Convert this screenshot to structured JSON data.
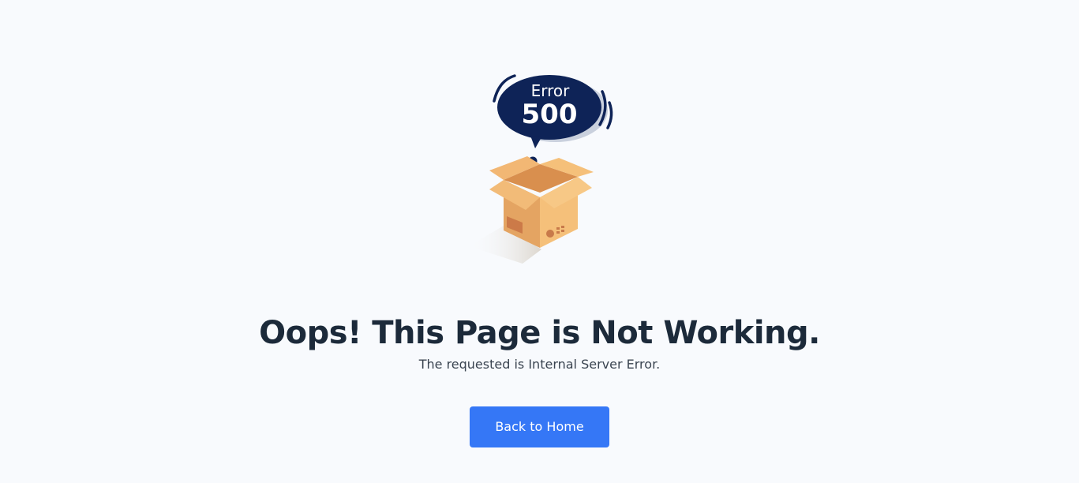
{
  "illustration": {
    "bubble_label": "Error",
    "bubble_code": "500",
    "icon": "open-box-icon"
  },
  "content": {
    "title": "Oops! This Page is Not Working.",
    "subtitle": "The requested is Internal Server Error."
  },
  "actions": {
    "home_label": "Back to Home"
  },
  "colors": {
    "background": "#f8fafd",
    "heading": "#1c2a3a",
    "bubble": "#0e2357",
    "box": "#f5c07a",
    "button": "#3577f6"
  }
}
